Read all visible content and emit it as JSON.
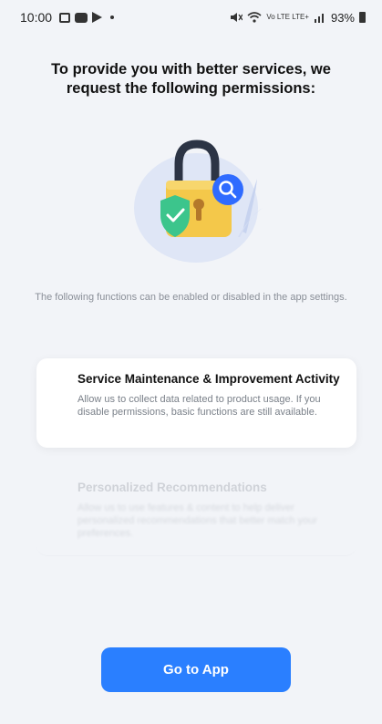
{
  "status_bar": {
    "time": "10:00",
    "signal_text": "Vo LTE LTE+",
    "battery": "93%"
  },
  "title": "To provide you with better services, we request the following permissions:",
  "illustration": {
    "icons": [
      "padlock-icon",
      "shield-check-icon",
      "search-icon"
    ],
    "colors": {
      "lock_body": "#f4c84a",
      "lock_shackle": "#2c3445",
      "shield": "#3cc58c",
      "search_badge": "#2f6bff",
      "backdrop": "#dfe6f6"
    }
  },
  "notice": "The following functions can be enabled or disabled in the app settings.",
  "permissions": [
    {
      "title": "Service Maintenance & Improvement Activity",
      "description": "Allow us to collect data related to product usage. If you disable permissions, basic functions are still available."
    },
    {
      "title": "Personalized Recommendations",
      "description": "Allow us to use features & content to help deliver personalized recommendations that better match your preferences."
    }
  ],
  "primary_button": {
    "label": "Go to App",
    "color": "#2a7fff"
  }
}
